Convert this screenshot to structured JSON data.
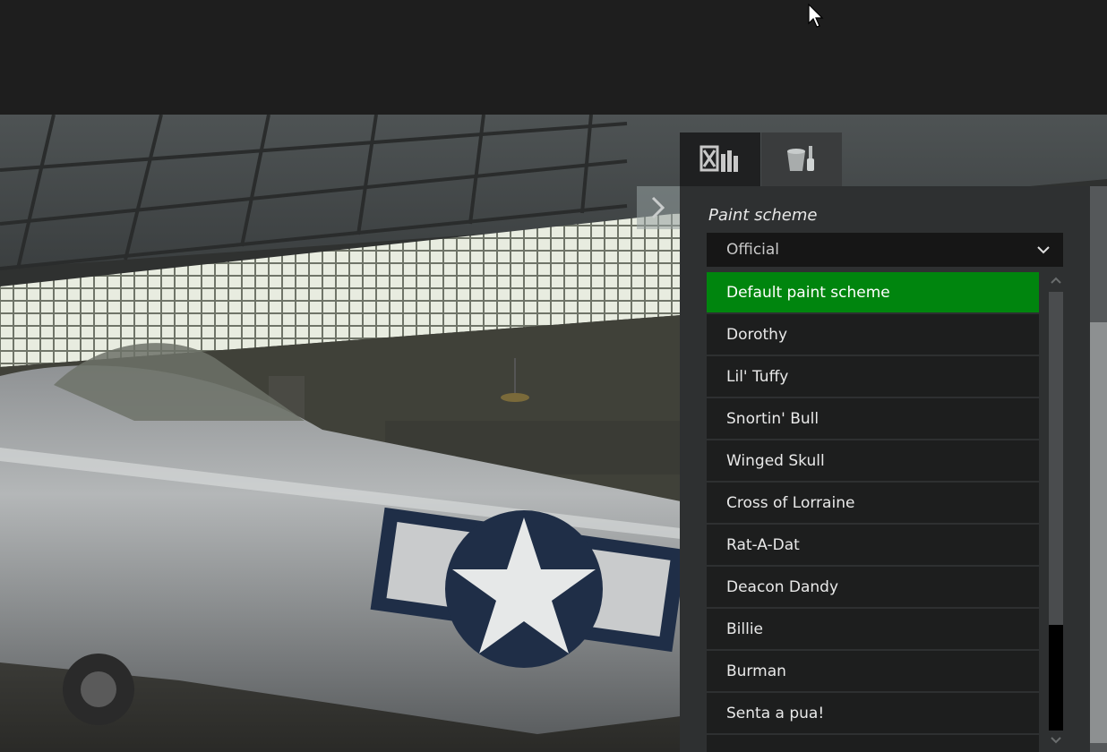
{
  "panel": {
    "title": "Paint scheme",
    "select": {
      "value": "Official"
    },
    "selected_index": 0,
    "items": [
      "Default paint scheme",
      "Dorothy",
      "Lil' Tuffy",
      "Snortin' Bull",
      "Winged Skull",
      "Cross of Lorraine",
      "Rat-A-Dat",
      "Deacon Dandy",
      "Billie",
      "Burman",
      "Senta a pua!",
      ""
    ],
    "scroll_thumb_fraction": 0.76
  },
  "tabs": [
    {
      "icon": "fuel-ammo-loadout-icon",
      "active": false
    },
    {
      "icon": "paint-bucket-brush-icon",
      "active": true
    }
  ],
  "colors": {
    "selected": "#00850e",
    "panel_bg": "#2e3031",
    "item_bg": "#1d1e1e"
  }
}
